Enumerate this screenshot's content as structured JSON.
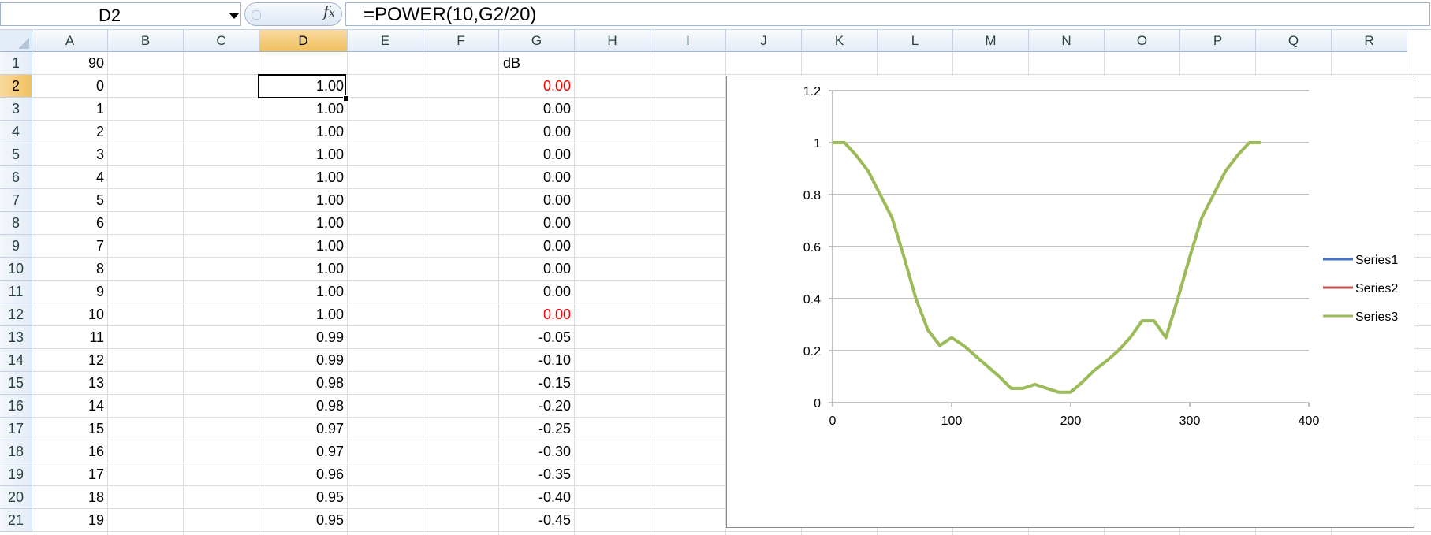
{
  "formula_bar": {
    "name_box": "D2",
    "fx_symbol": "fx",
    "formula": "=POWER(10,G2/20)"
  },
  "columns": [
    "A",
    "B",
    "C",
    "D",
    "E",
    "F",
    "G",
    "H",
    "I",
    "J",
    "K",
    "L",
    "M",
    "N",
    "O",
    "P",
    "Q",
    "R"
  ],
  "selected_column": "D",
  "rows": [
    "1",
    "2",
    "3",
    "4",
    "5",
    "6",
    "7",
    "8",
    "9",
    "10",
    "11",
    "12",
    "13",
    "14",
    "15",
    "16",
    "17",
    "18",
    "19",
    "20",
    "21"
  ],
  "selected_row": "2",
  "cells": {
    "A": [
      "90",
      "0",
      "1",
      "2",
      "3",
      "4",
      "5",
      "6",
      "7",
      "8",
      "9",
      "10",
      "11",
      "12",
      "13",
      "14",
      "15",
      "16",
      "17",
      "18",
      "19"
    ],
    "D": [
      "",
      "1.00",
      "1.00",
      "1.00",
      "1.00",
      "1.00",
      "1.00",
      "1.00",
      "1.00",
      "1.00",
      "1.00",
      "1.00",
      "0.99",
      "0.99",
      "0.98",
      "0.98",
      "0.97",
      "0.97",
      "0.96",
      "0.95",
      "0.95"
    ],
    "G": [
      "dB",
      "0.00",
      "0.00",
      "0.00",
      "0.00",
      "0.00",
      "0.00",
      "0.00",
      "0.00",
      "0.00",
      "0.00",
      "0.00",
      "-0.05",
      "-0.10",
      "-0.15",
      "-0.20",
      "-0.25",
      "-0.30",
      "-0.35",
      "-0.40",
      "-0.45"
    ]
  },
  "red_cells": [
    "G2",
    "G12"
  ],
  "chart_data": {
    "type": "line",
    "xlim": [
      0,
      400
    ],
    "ylim": [
      0,
      1.2
    ],
    "x_ticks": [
      "0",
      "100",
      "200",
      "300",
      "400"
    ],
    "y_ticks": [
      "0",
      "0.2",
      "0.4",
      "0.6",
      "0.8",
      "1",
      "1.2"
    ],
    "grid": true,
    "legend_position": "right",
    "series": [
      {
        "name": "Series1",
        "color": "#4472c4",
        "points": []
      },
      {
        "name": "Series2",
        "color": "#c0504d",
        "points": []
      },
      {
        "name": "Series3",
        "color": "#9bbb59",
        "points": [
          [
            0,
            1.0
          ],
          [
            10,
            1.0
          ],
          [
            20,
            0.95
          ],
          [
            30,
            0.89
          ],
          [
            40,
            0.8
          ],
          [
            50,
            0.71
          ],
          [
            60,
            0.56
          ],
          [
            70,
            0.4
          ],
          [
            80,
            0.28
          ],
          [
            90,
            0.22
          ],
          [
            100,
            0.25
          ],
          [
            110,
            0.22
          ],
          [
            120,
            0.18
          ],
          [
            130,
            0.14
          ],
          [
            140,
            0.1
          ],
          [
            150,
            0.055
          ],
          [
            160,
            0.055
          ],
          [
            170,
            0.07
          ],
          [
            180,
            0.055
          ],
          [
            190,
            0.04
          ],
          [
            200,
            0.04
          ],
          [
            210,
            0.08
          ],
          [
            220,
            0.125
          ],
          [
            230,
            0.16
          ],
          [
            240,
            0.2
          ],
          [
            250,
            0.25
          ],
          [
            260,
            0.315
          ],
          [
            270,
            0.315
          ],
          [
            280,
            0.25
          ],
          [
            290,
            0.4
          ],
          [
            300,
            0.56
          ],
          [
            310,
            0.71
          ],
          [
            320,
            0.8
          ],
          [
            330,
            0.89
          ],
          [
            340,
            0.95
          ],
          [
            350,
            1.0
          ],
          [
            360,
            1.0
          ]
        ]
      }
    ]
  }
}
